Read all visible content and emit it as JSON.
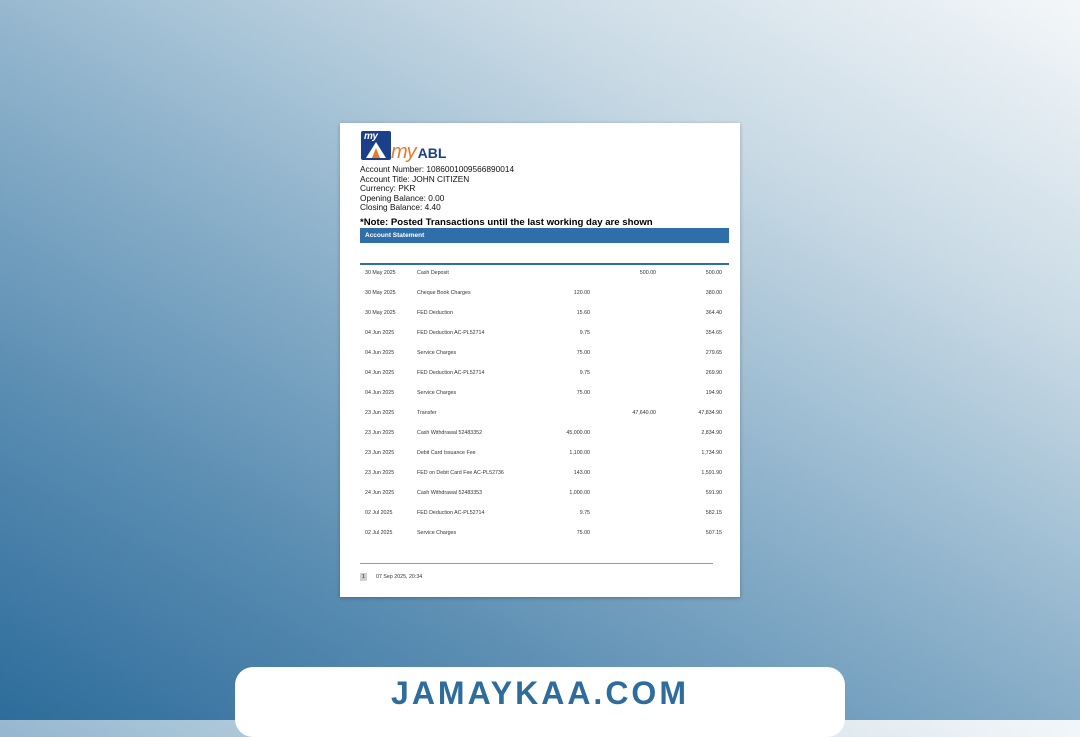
{
  "logo": {
    "badge": "my",
    "word_my": "my",
    "word_abl": "ABL"
  },
  "account": {
    "number": "Account Number: 1086001009566890014",
    "title": "Account Title: JOHN CITIZEN",
    "currency": "Currency: PKR",
    "opening": "Opening Balance: 0.00",
    "closing": "Closing Balance: 4.40"
  },
  "note": "*Note: Posted Transactions until the last working day are shown",
  "section_header": "Account Statement",
  "transactions": [
    {
      "date": "30 May 2025",
      "desc": "Cash Deposit",
      "debit": "",
      "credit": "500.00",
      "balance": "500.00"
    },
    {
      "date": "30 May 2025",
      "desc": "Cheque Book Charges",
      "debit": "120.00",
      "credit": "",
      "balance": "380.00"
    },
    {
      "date": "30 May 2025",
      "desc": "FED Deduction",
      "debit": "15.60",
      "credit": "",
      "balance": "364.40"
    },
    {
      "date": "04 Jun 2025",
      "desc": "FED Deduction AC-PL52714",
      "debit": "9.75",
      "credit": "",
      "balance": "354.65"
    },
    {
      "date": "04 Jun 2025",
      "desc": "Service Charges",
      "debit": "75.00",
      "credit": "",
      "balance": "279.65"
    },
    {
      "date": "04 Jun 2025",
      "desc": "FED Deduction AC-PL52714",
      "debit": "9.75",
      "credit": "",
      "balance": "269.90"
    },
    {
      "date": "04 Jun 2025",
      "desc": "Service Charges",
      "debit": "75.00",
      "credit": "",
      "balance": "194.90"
    },
    {
      "date": "23 Jun 2025",
      "desc": "Transfer",
      "debit": "",
      "credit": "47,640.00",
      "balance": "47,834.90"
    },
    {
      "date": "23 Jun 2025",
      "desc": "Cash Withdrawal 52483352",
      "debit": "45,000.00",
      "credit": "",
      "balance": "2,834.90"
    },
    {
      "date": "23 Jun 2025",
      "desc": "Debit Card Issuance Fee",
      "debit": "1,100.00",
      "credit": "",
      "balance": "1,734.90"
    },
    {
      "date": "23 Jun 2025",
      "desc": "FED on Debit Card Fee AC-PL52736",
      "debit": "143.00",
      "credit": "",
      "balance": "1,591.90"
    },
    {
      "date": "24 Jun 2025",
      "desc": "Cash Withdrawal 52483353",
      "debit": "1,000.00",
      "credit": "",
      "balance": "591.90"
    },
    {
      "date": "02 Jul 2025",
      "desc": "FED Deduction AC-PL52714",
      "debit": "9.75",
      "credit": "",
      "balance": "582.15"
    },
    {
      "date": "02 Jul 2025",
      "desc": "Service Charges",
      "debit": "75.00",
      "credit": "",
      "balance": "507.15"
    }
  ],
  "footer": {
    "page": "1",
    "timestamp": "07 Sep 2025, 20:34"
  },
  "watermark": "JAMAYKAA.COM",
  "colors": {
    "accent": "#2f6ea9",
    "brand_orange": "#e9792b",
    "brand_navy": "#1c3f8a"
  }
}
